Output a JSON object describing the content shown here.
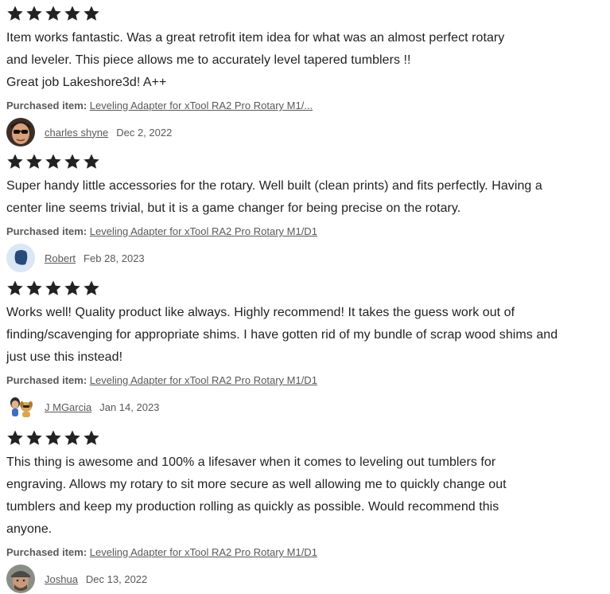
{
  "rating_star_color": "#222222",
  "purchased_label": "Purchased item:",
  "reviews": [
    {
      "rating": 5,
      "text_lines": [
        "Item works fantastic. Was a great retrofit item idea for what was an almost perfect rotary",
        "and leveler. This piece allows me to accurately level tapered tumblers !!",
        "Great job Lakeshore3d! A++"
      ],
      "purchased_item": "Leveling Adapter for xTool RA2 Pro Rotary M1/...",
      "reviewer": "charles shyne",
      "date": "Dec 2, 2022",
      "avatar_icon": "person-sunglasses-avatar"
    },
    {
      "rating": 5,
      "text_lines": [
        "Super handy little accessories for the rotary. Well built (clean prints) and fits perfectly. Having a",
        "center line seems trivial, but it is a game changer for being precise on the rotary."
      ],
      "purchased_item": "Leveling Adapter for xTool RA2 Pro Rotary M1/D1",
      "reviewer": "Robert",
      "date": "Feb 28, 2023",
      "avatar_icon": "default-blue-avatar"
    },
    {
      "rating": 5,
      "text_lines": [
        "Works well! Quality product like always. Highly recommend! It takes the guess work out of",
        "finding/scavenging for appropriate shims. I have gotten rid of my bundle of scrap wood shims and",
        "just use this instead!"
      ],
      "purchased_item": "Leveling Adapter for xTool RA2 Pro Rotary M1/D1",
      "reviewer": "J MGarcia",
      "date": "Jan 14, 2023",
      "avatar_icon": "cartoon-person-dog-avatar"
    },
    {
      "rating": 5,
      "text_lines": [
        "This thing is awesome and 100% a lifesaver when it comes to leveling out tumblers for",
        "engraving. Allows my rotary to sit more secure as well allowing me to quickly change out",
        "tumblers and keep my production rolling as quickly as possible. Would recommend this",
        "anyone."
      ],
      "purchased_item": "Leveling Adapter for xTool RA2 Pro Rotary M1/D1",
      "reviewer": "Joshua",
      "date": "Dec 13, 2022",
      "avatar_icon": "person-cap-avatar"
    }
  ]
}
